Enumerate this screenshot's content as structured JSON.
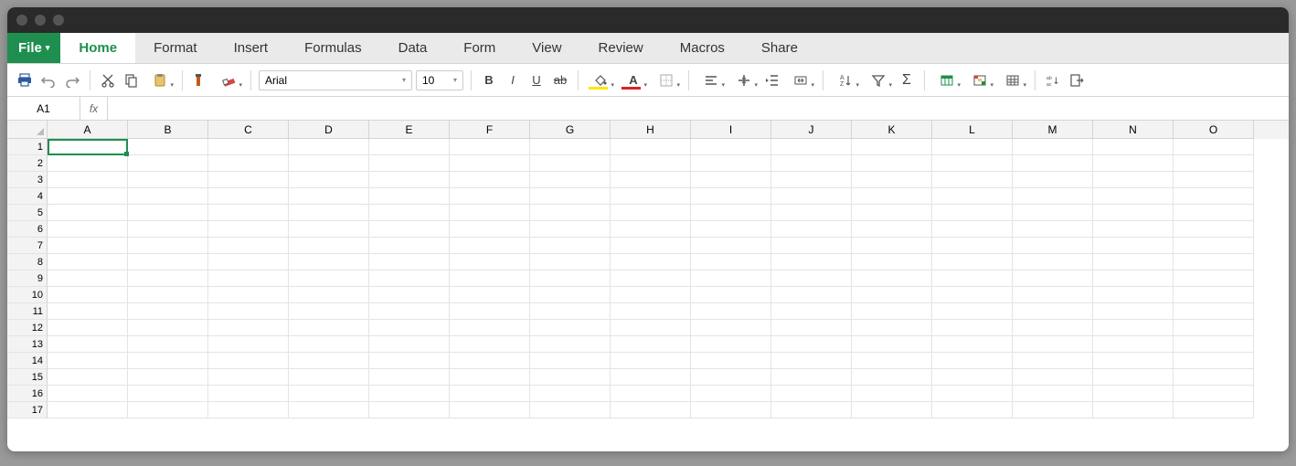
{
  "window": {
    "title": ""
  },
  "menu": {
    "file": "File",
    "tabs": [
      "Home",
      "Format",
      "Insert",
      "Formulas",
      "Data",
      "Form",
      "View",
      "Review",
      "Macros",
      "Share"
    ],
    "active": 0
  },
  "toolbar": {
    "font_name": "Arial",
    "font_size": "10",
    "bold": "B",
    "italic": "I",
    "underline": "U",
    "strike": "ab",
    "fill_color": "#ffe600",
    "font_color": "#d62424",
    "text_color_glyph": "A",
    "icons": {
      "print": "print-icon",
      "undo": "undo-icon",
      "redo": "redo-icon",
      "cut": "cut-icon",
      "copy": "copy-icon",
      "paste": "paste-icon",
      "format_painter": "paintbrush-icon",
      "clear": "clear-format-icon",
      "fill": "paint-bucket-icon",
      "borders": "borders-icon",
      "align_h": "align-left-icon",
      "align_v": "align-middle-icon",
      "indent": "indent-icon",
      "merge": "merge-cells-icon",
      "sort": "sort-icon",
      "filter": "filter-icon",
      "sum": "sum-icon",
      "table1": "table-style-icon",
      "table2": "conditional-format-icon",
      "table3": "insert-table-icon",
      "replace": "replace-icon",
      "export": "export-icon"
    }
  },
  "formula_bar": {
    "name_box": "A1",
    "fx_label": "fx",
    "formula": ""
  },
  "grid": {
    "columns": [
      "A",
      "B",
      "C",
      "D",
      "E",
      "F",
      "G",
      "H",
      "I",
      "J",
      "K",
      "L",
      "M",
      "N",
      "O"
    ],
    "rows": [
      1,
      2,
      3,
      4,
      5,
      6,
      7,
      8,
      9,
      10,
      11,
      12,
      13,
      14,
      15,
      16,
      17
    ],
    "selected_cell": "A1"
  }
}
